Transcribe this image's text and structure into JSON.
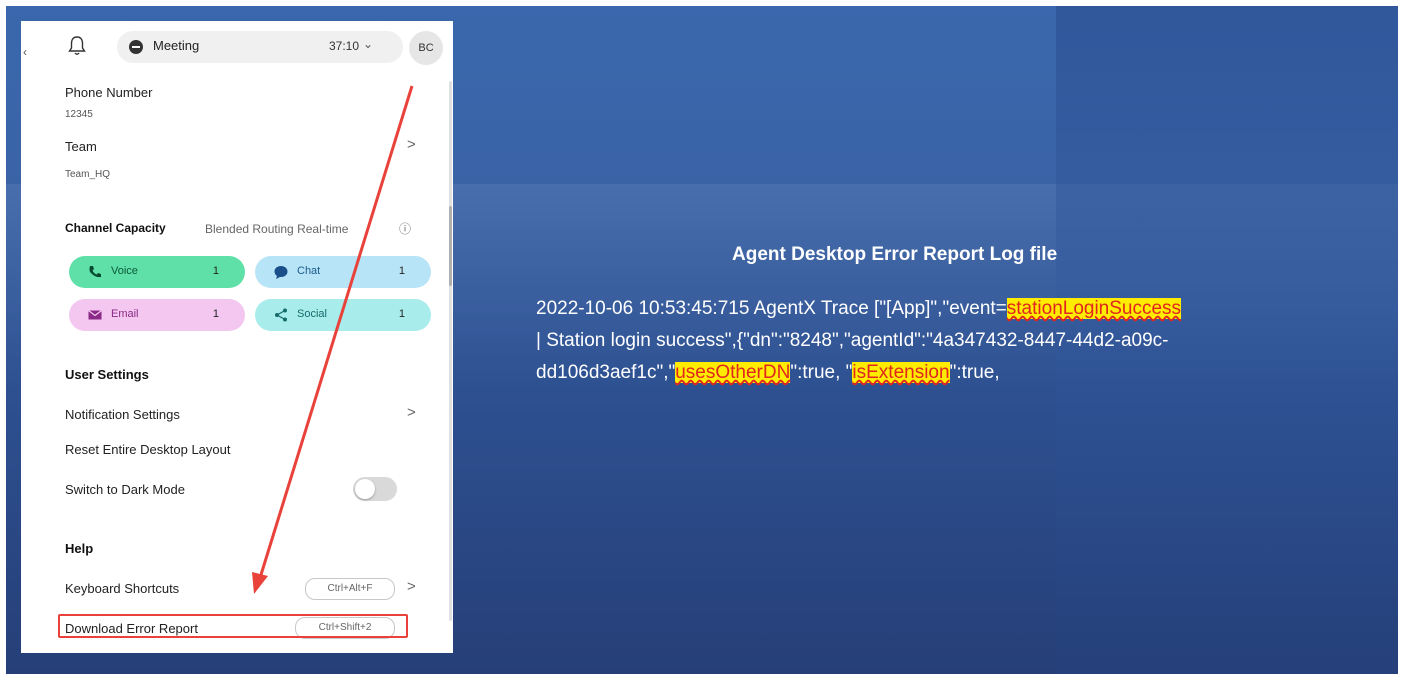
{
  "window": {
    "title": "Agent Desktop Error Report Log file"
  },
  "topbar": {
    "back_glyph": "‹",
    "bell_icon": "bell-icon",
    "status_label": "Meeting",
    "timer": "37:10",
    "chevron": "⌄",
    "avatar_initials": "BC"
  },
  "profile": {
    "phone_label": "Phone Number",
    "phone_value": "12345",
    "team_label": "Team",
    "team_value": "Team_HQ",
    "chevron": ">"
  },
  "channel_capacity": {
    "heading": "Channel Capacity",
    "routing_label": "Blended Routing Real-time",
    "info_icon": "ⓘ",
    "channels": [
      {
        "name": "Voice",
        "count": "1",
        "bg": "#5fe0a8",
        "icon": "phone-icon",
        "color": "#0a5a3a"
      },
      {
        "name": "Chat",
        "count": "1",
        "bg": "#b8e4f8",
        "icon": "chat-icon",
        "color": "#1a5c8a"
      },
      {
        "name": "Email",
        "count": "1",
        "bg": "#f3c7f0",
        "icon": "email-icon",
        "color": "#8a2a86"
      },
      {
        "name": "Social",
        "count": "1",
        "bg": "#a8ecec",
        "icon": "share-icon",
        "color": "#166b6b"
      }
    ]
  },
  "user_settings": {
    "heading": "User Settings",
    "notification_label": "Notification Settings",
    "reset_label": "Reset Entire Desktop Layout",
    "dark_mode_label": "Switch to Dark Mode",
    "dark_mode_on": false
  },
  "help": {
    "heading": "Help",
    "shortcuts_label": "Keyboard Shortcuts",
    "shortcuts_key": "Ctrl+Alt+F",
    "download_label": "Download Error Report",
    "download_key": "Ctrl+Shift+2"
  },
  "report": {
    "title": "Agent Desktop Error Report Log file",
    "line1_a": "2022-10-06 10:53:45:715 AgentX Trace [\"[App]\",\"event=",
    "line1_hl": "stationLoginSuccess",
    "line2": "| Station login success\",{\"dn\":\"8248\",\"agentId\":\"4a347432-8447-44d2-a09c-",
    "line3_a": "dd106d3aef1c\",\"",
    "line3_hl1": "usesOtherDN",
    "line3_b": "\":true, \"",
    "line3_hl2": "isExtension",
    "line3_c": "\":true,"
  },
  "colors": {
    "highlight_bg": "#ffec00",
    "highlight_text": "#e0261f",
    "annotation_red": "#e8423a",
    "background_blue": "#3a63a6"
  }
}
